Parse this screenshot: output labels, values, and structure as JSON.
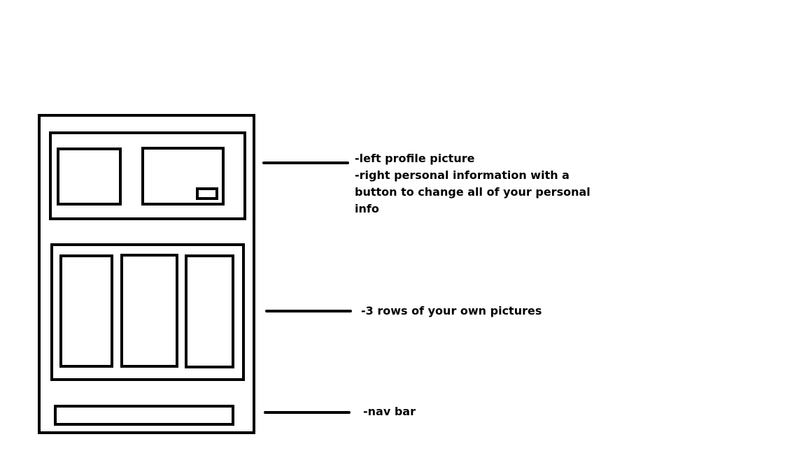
{
  "annotations": {
    "profile_section": {
      "lines": [
        "-left profile picture",
        "-right personal information with a",
        "button to change all of your personal",
        "info"
      ]
    },
    "pictures_section": {
      "lines": [
        "-3 rows of your own pictures"
      ]
    },
    "nav_section": {
      "lines": [
        "-nav bar"
      ]
    }
  },
  "colors": {
    "stroke": "#000000",
    "background": "#ffffff"
  }
}
